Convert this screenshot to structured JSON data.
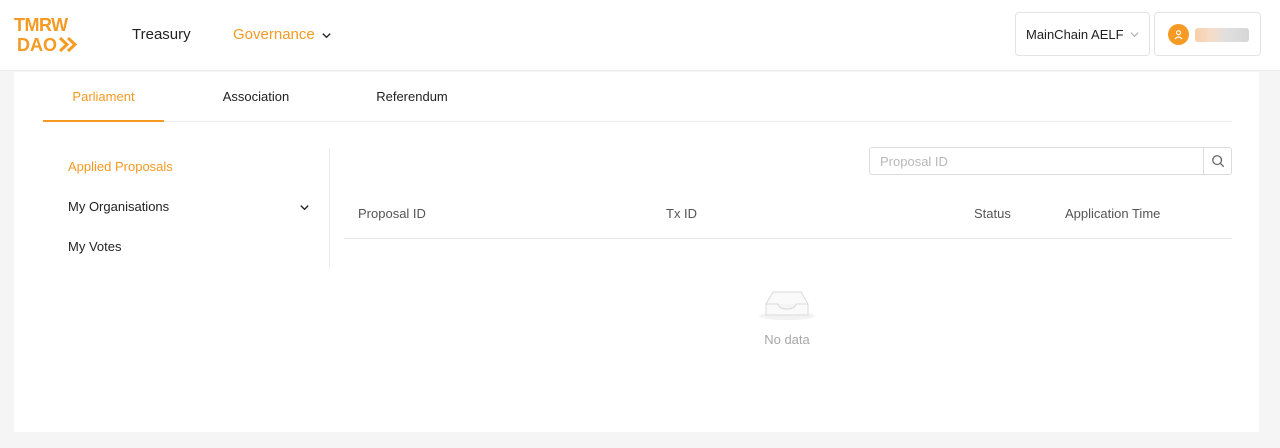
{
  "header": {
    "logo_text_top": "TMRW",
    "logo_text_bottom": "DAO",
    "nav": {
      "treasury_label": "Treasury",
      "governance_label": "Governance"
    },
    "chain_selector": {
      "value": "MainChain AELF"
    },
    "account": {
      "avatar_icon": "user-icon"
    }
  },
  "tabs": [
    {
      "label": "Parliament"
    },
    {
      "label": "Association"
    },
    {
      "label": "Referendum"
    }
  ],
  "sidebar": {
    "items": [
      {
        "label": "Applied Proposals"
      },
      {
        "label": "My Organisations"
      },
      {
        "label": "My Votes"
      }
    ]
  },
  "search": {
    "placeholder": "Proposal ID",
    "value": ""
  },
  "table": {
    "columns": [
      "Proposal ID",
      "Tx ID",
      "Status",
      "Application Time"
    ],
    "rows": [],
    "empty_text": "No data"
  },
  "colors": {
    "accent": "#f59a23",
    "background": "#f5f5f5",
    "surface": "#ffffff"
  }
}
